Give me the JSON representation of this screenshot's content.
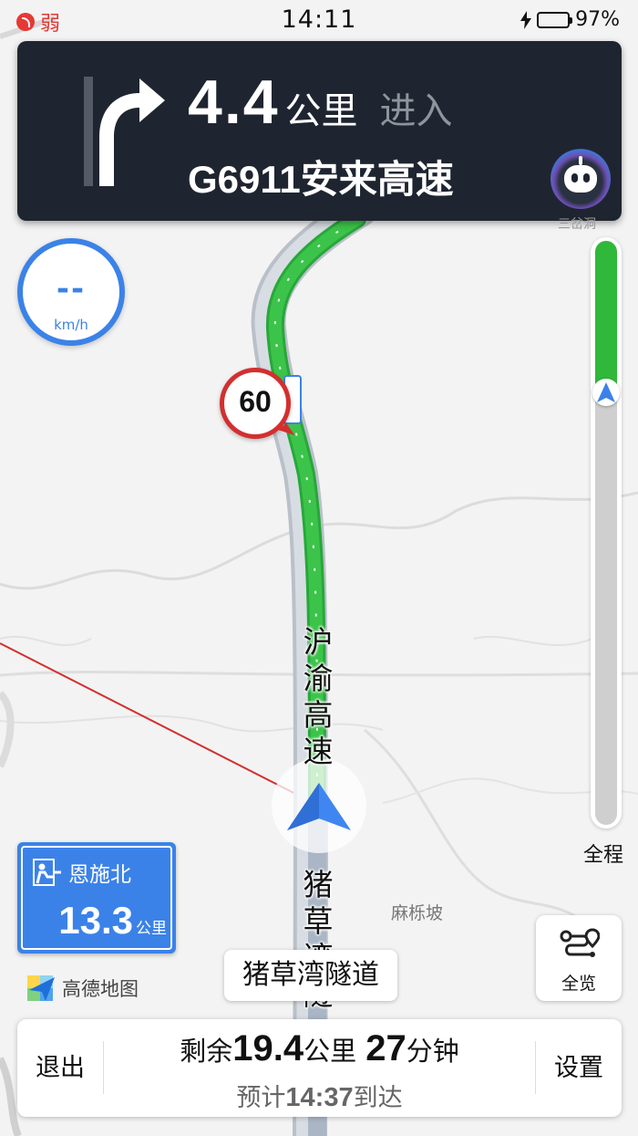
{
  "status_bar": {
    "signal_text": "弱",
    "time": "14:11",
    "battery_percent": "97%"
  },
  "guidance": {
    "maneuver_icon": "turn-right-arrow",
    "distance_value": "4.4",
    "distance_unit": "公里",
    "action": "进入",
    "road_name": "G6911安来高速",
    "assistant_icon": "voice-assistant-robot-icon"
  },
  "speedometer": {
    "value": "--",
    "unit": "km/h"
  },
  "speed_limit": {
    "value": "60"
  },
  "route_progress": {
    "completed_fraction": 0.26,
    "label": "全程"
  },
  "map": {
    "road_label_primary": "沪渝高速",
    "road_label_secondary": "猪草湾隧道",
    "place_label": "麻栎坡",
    "place_label_top": "三岔洞",
    "colors": {
      "route_green": "#2fb83a",
      "accent_blue": "#3b82e8",
      "limit_red": "#d32f2f"
    }
  },
  "exit_sign": {
    "name": "恩施北",
    "distance_value": "13.3",
    "distance_unit": "公里"
  },
  "logo": {
    "text": "高德地图"
  },
  "current_road": {
    "name": "猪草湾隧道"
  },
  "overview_button": {
    "label": "全览"
  },
  "bottom_bar": {
    "exit_label": "退出",
    "settings_label": "设置",
    "remaining_prefix": "剩余",
    "remaining_distance": "19.4",
    "remaining_distance_unit": "公里",
    "remaining_time": "27",
    "remaining_time_unit": "分钟",
    "eta_prefix": "预计",
    "eta_time": "14:37",
    "eta_suffix": "到达"
  }
}
